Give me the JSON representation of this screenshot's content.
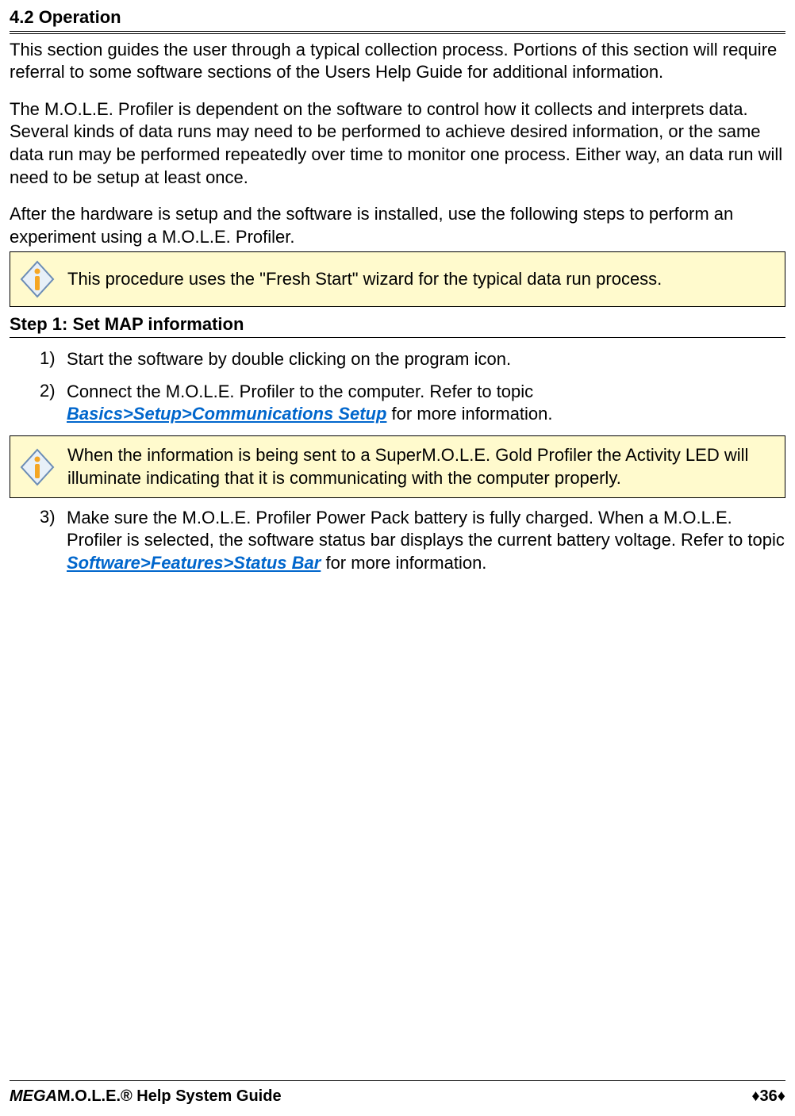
{
  "section_heading": "4.2 Operation",
  "para1": "This section guides the user through a typical collection process. Portions of this section will require referral to some software sections of the Users Help Guide for additional information.",
  "para2": "The M.O.L.E. Profiler is dependent on the software to control how it collects and interprets data. Several kinds of data runs may need to be performed to achieve desired information, or the same data run may be performed repeatedly over time to monitor one process. Either way, an data run will need to be setup at least once.",
  "para3": "After the hardware is setup and the software is installed, use the following steps to perform an experiment using a M.O.L.E. Profiler.",
  "note1": "This procedure uses the \"Fresh Start\" wizard for the typical data run process.",
  "step_heading": "Step 1: Set MAP information",
  "steps": [
    {
      "num": "1)",
      "text_before": "Start the software by double clicking on the program icon.",
      "link": "",
      "text_after": ""
    },
    {
      "num": "2)",
      "text_before": "Connect the M.O.L.E. Profiler to the computer. Refer to topic ",
      "link": "Basics>Setup>Communications Setup",
      "text_after": " for more information."
    }
  ],
  "note2": "When the information is being sent to a SuperM.O.L.E. Gold Profiler the Activity LED will illuminate indicating that it is communicating with the computer properly.",
  "step3": {
    "num": "3)",
    "text_before": "Make sure the M.O.L.E. Profiler Power Pack battery is fully charged. When a M.O.L.E. Profiler is selected, the software status bar displays the current battery voltage. Refer to topic ",
    "link": "Software>Features>Status Bar",
    "text_after": " for more information."
  },
  "footer": {
    "left_mega": "MEGA",
    "left_rest": "M.O.L.E.® Help System Guide",
    "right": "♦36♦"
  }
}
